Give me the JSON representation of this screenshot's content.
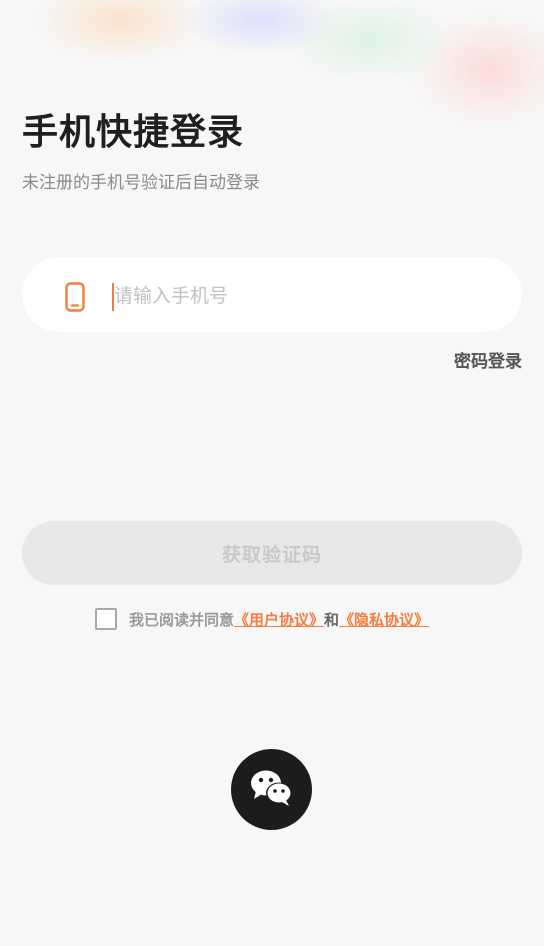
{
  "header": {
    "title": "手机快捷登录",
    "subtitle": "未注册的手机号验证后自动登录"
  },
  "phone_field": {
    "icon": "mobile-phone-icon",
    "value": "",
    "placeholder": "请输入手机号"
  },
  "password_login": {
    "label": "密码登录"
  },
  "get_code_button": {
    "label": "获取验证码"
  },
  "agreement": {
    "checked": false,
    "prefix": "我已阅读并同意",
    "user_agreement": "《用户协议》",
    "and": "和",
    "privacy_policy": "《隐私协议》"
  },
  "wechat_login": {
    "icon": "wechat-icon"
  },
  "colors": {
    "accent": "#f27d40",
    "background": "#f7f7f7",
    "button_disabled_bg": "#e8e8e8",
    "button_disabled_text": "#c9c9c9",
    "wechat_bg": "#1c1c1c"
  }
}
